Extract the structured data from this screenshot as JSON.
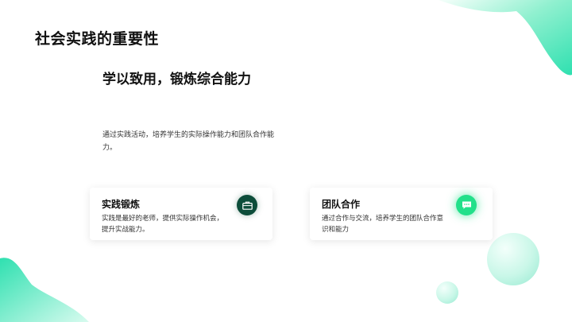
{
  "slide": {
    "title": "社会实践的重要性",
    "subtitle": "学以致用，锻炼综合能力",
    "description": "通过实践活动，培养学生的实际操作能力和团队合作能力。"
  },
  "cards": [
    {
      "title": "实践锻炼",
      "text": "实践是最好的老师，提供实际操作机会，提升实战能力。",
      "icon": "briefcase-icon",
      "icon_color": "#0d4d3a"
    },
    {
      "title": "团队合作",
      "text": "通过合作与交流，培养学生的团队合作意识和能力",
      "icon": "chat-icon",
      "icon_color": "#22e08a"
    }
  ],
  "colors": {
    "accent": "#2ee6b0",
    "accent_light": "#b8f5e3"
  }
}
